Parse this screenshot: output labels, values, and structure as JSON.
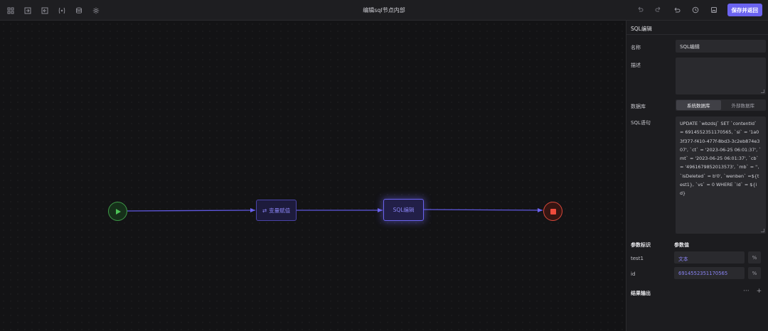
{
  "toolbar": {
    "left_icons": [
      "layout-icon",
      "import-icon",
      "export-icon",
      "variable-icon",
      "database-icon",
      "settings-icon"
    ],
    "title": "编辑sql节点内部",
    "right_icons": [
      "undo-icon",
      "redo-icon",
      "revert-icon",
      "history-icon",
      "save-icon"
    ],
    "save_label": "保存并返回"
  },
  "canvas": {
    "nodes": {
      "var_label": "变量赋值",
      "sql_label": "SQL编辑"
    },
    "colors": {
      "edge": "#6b63f0",
      "start": "#4dc257",
      "end": "#f04b3c"
    }
  },
  "panel": {
    "title": "SQL编辑",
    "name_label": "名称",
    "name_value": "SQL编辑",
    "desc_label": "描述",
    "desc_value": "",
    "db_label": "数据库",
    "db_options": [
      "系统数据库",
      "外部数据库"
    ],
    "db_selected": "系统数据库",
    "sql_label": "SQL语句",
    "sql_value": "UPDATE `wbzdsj` SET `contentId` = 6914552351170565, `si` = '1a03f377-f410-477f-8bd3-3c2eb874e307', `ct` = '2023-06-25 06:01:37', `mt` = '2023-06-25 06:01:37', `cb` = '4961679852013573', `mb` = '', `isDeleted` = b'0', `wenben` =${test1}, `vs` = 0 WHERE `id` = ${id}",
    "param_headers": {
      "key": "参数标识",
      "value": "参数值"
    },
    "params": [
      {
        "key": "test1",
        "value": "文本"
      },
      {
        "key": "id",
        "value": "6914552351170565"
      }
    ],
    "result_label": "结果输出",
    "result_more": "···",
    "result_add": "+"
  }
}
